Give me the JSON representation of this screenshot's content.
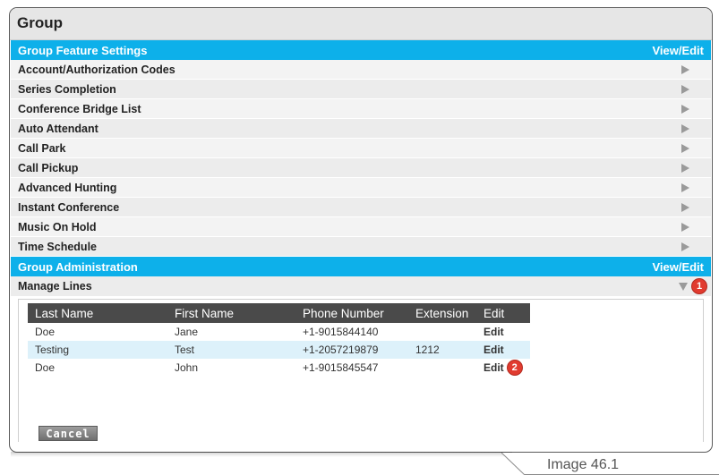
{
  "panel": {
    "title": "Group"
  },
  "feature_settings": {
    "title": "Group Feature Settings",
    "view_edit": "View/Edit",
    "items": [
      "Account/Authorization Codes",
      "Series Completion",
      "Conference Bridge List",
      "Auto Attendant",
      "Call Park",
      "Call Pickup",
      "Advanced Hunting",
      "Instant Conference",
      "Music On Hold",
      "Time Schedule"
    ]
  },
  "administration": {
    "title": "Group Administration",
    "view_edit": "View/Edit",
    "manage_lines": "Manage Lines",
    "badge": "1"
  },
  "lines_table": {
    "headers": [
      "Last Name",
      "First Name",
      "Phone Number",
      "Extension",
      "Edit"
    ],
    "rows": [
      {
        "last": "Doe",
        "first": "Jane",
        "phone": "+1-9015844140",
        "ext": "",
        "edit": "Edit"
      },
      {
        "last": "Testing",
        "first": "Test",
        "phone": "+1-2057219879",
        "ext": "1212",
        "edit": "Edit"
      },
      {
        "last": "Doe",
        "first": "John",
        "phone": "+1-9015845547",
        "ext": "",
        "edit": "Edit"
      }
    ],
    "edit_badge": "2"
  },
  "cancel_label": "Cancel",
  "caption": "Image 46.1",
  "colors": {
    "section_header": "#0db0ea",
    "table_header": "#4a4a4a",
    "alt_row": "#ddf1fa",
    "badge": "#e13b2f"
  }
}
